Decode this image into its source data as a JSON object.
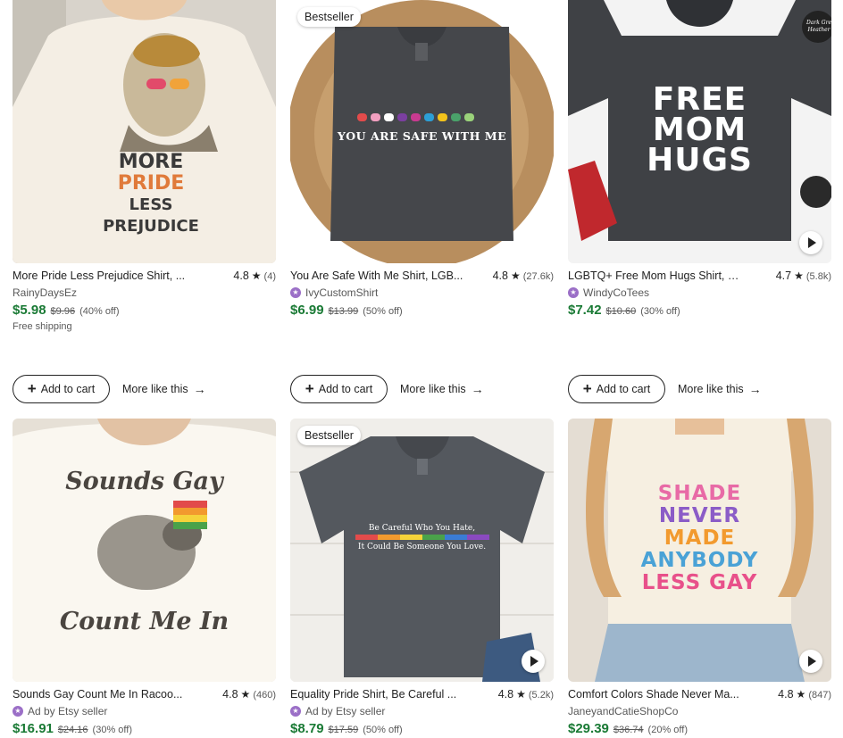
{
  "products": [
    {
      "title": "More Pride Less Prejudice Shirt, ...",
      "rating": "4.8",
      "reviews": "(4)",
      "seller": "RainyDaysEz",
      "star_seller": false,
      "price": "$5.98",
      "original_price": "$9.96",
      "discount": "(40% off)",
      "shipping": "Free shipping",
      "image_text": [
        "MORE",
        "PRIDE",
        "LESS PREJUDICE"
      ]
    },
    {
      "title": "You Are Safe With Me Shirt, LGB...",
      "rating": "4.8",
      "reviews": "(27.6k)",
      "seller": "IvyCustomShirt",
      "star_seller": true,
      "price": "$6.99",
      "original_price": "$13.99",
      "discount": "(50% off)",
      "badge": "Bestseller",
      "image_text": [
        "YOU ARE SAFE WITH ME"
      ]
    },
    {
      "title": "LGBTQ+ Free Mom Hugs Shirt, G...",
      "rating": "4.7",
      "reviews": "(5.8k)",
      "seller": "WindyCoTees",
      "star_seller": true,
      "price": "$7.42",
      "original_price": "$10.60",
      "discount": "(30% off)",
      "has_video": true,
      "image_text": [
        "FREE",
        "MOM",
        "HUGS",
        "Dark Gre",
        "Heather"
      ]
    },
    {
      "title": "Sounds Gay Count Me In Racoo...",
      "rating": "4.8",
      "reviews": "(460)",
      "seller": "Ad by Etsy seller",
      "star_seller": true,
      "price": "$16.91",
      "original_price": "$24.16",
      "discount": "(30% off)",
      "image_text": [
        "Sounds Gay",
        "Count Me In"
      ]
    },
    {
      "title": "Equality Pride Shirt, Be Careful ...",
      "rating": "4.8",
      "reviews": "(5.2k)",
      "seller": "Ad by Etsy seller",
      "star_seller": true,
      "price": "$8.79",
      "original_price": "$17.59",
      "discount": "(50% off)",
      "badge": "Bestseller",
      "has_video": true,
      "image_text": [
        "Be Careful Who You Hate,",
        "It Could Be Someone You Love."
      ]
    },
    {
      "title": "Comfort Colors Shade Never Ma...",
      "rating": "4.8",
      "reviews": "(847)",
      "seller": "JaneyandCatieShopCo",
      "star_seller": false,
      "price": "$29.39",
      "original_price": "$36.74",
      "discount": "(20% off)",
      "has_video": true,
      "image_text": [
        "SHADE",
        "NEVER",
        "MADE",
        "ANYBODY",
        "LESS GAY"
      ]
    }
  ],
  "actions": {
    "add_to_cart": "Add to cart",
    "more_like_this": "More like this"
  },
  "colors": {
    "price_green": "#1a7a35",
    "star_seller_purple": "#9b6fc7",
    "text": "#222222",
    "muted": "#595959"
  },
  "icons": {
    "star": "star-icon",
    "plus": "plus-icon",
    "arrow": "arrow-right-icon",
    "play": "play-icon",
    "star_seller": "star-seller-icon"
  }
}
